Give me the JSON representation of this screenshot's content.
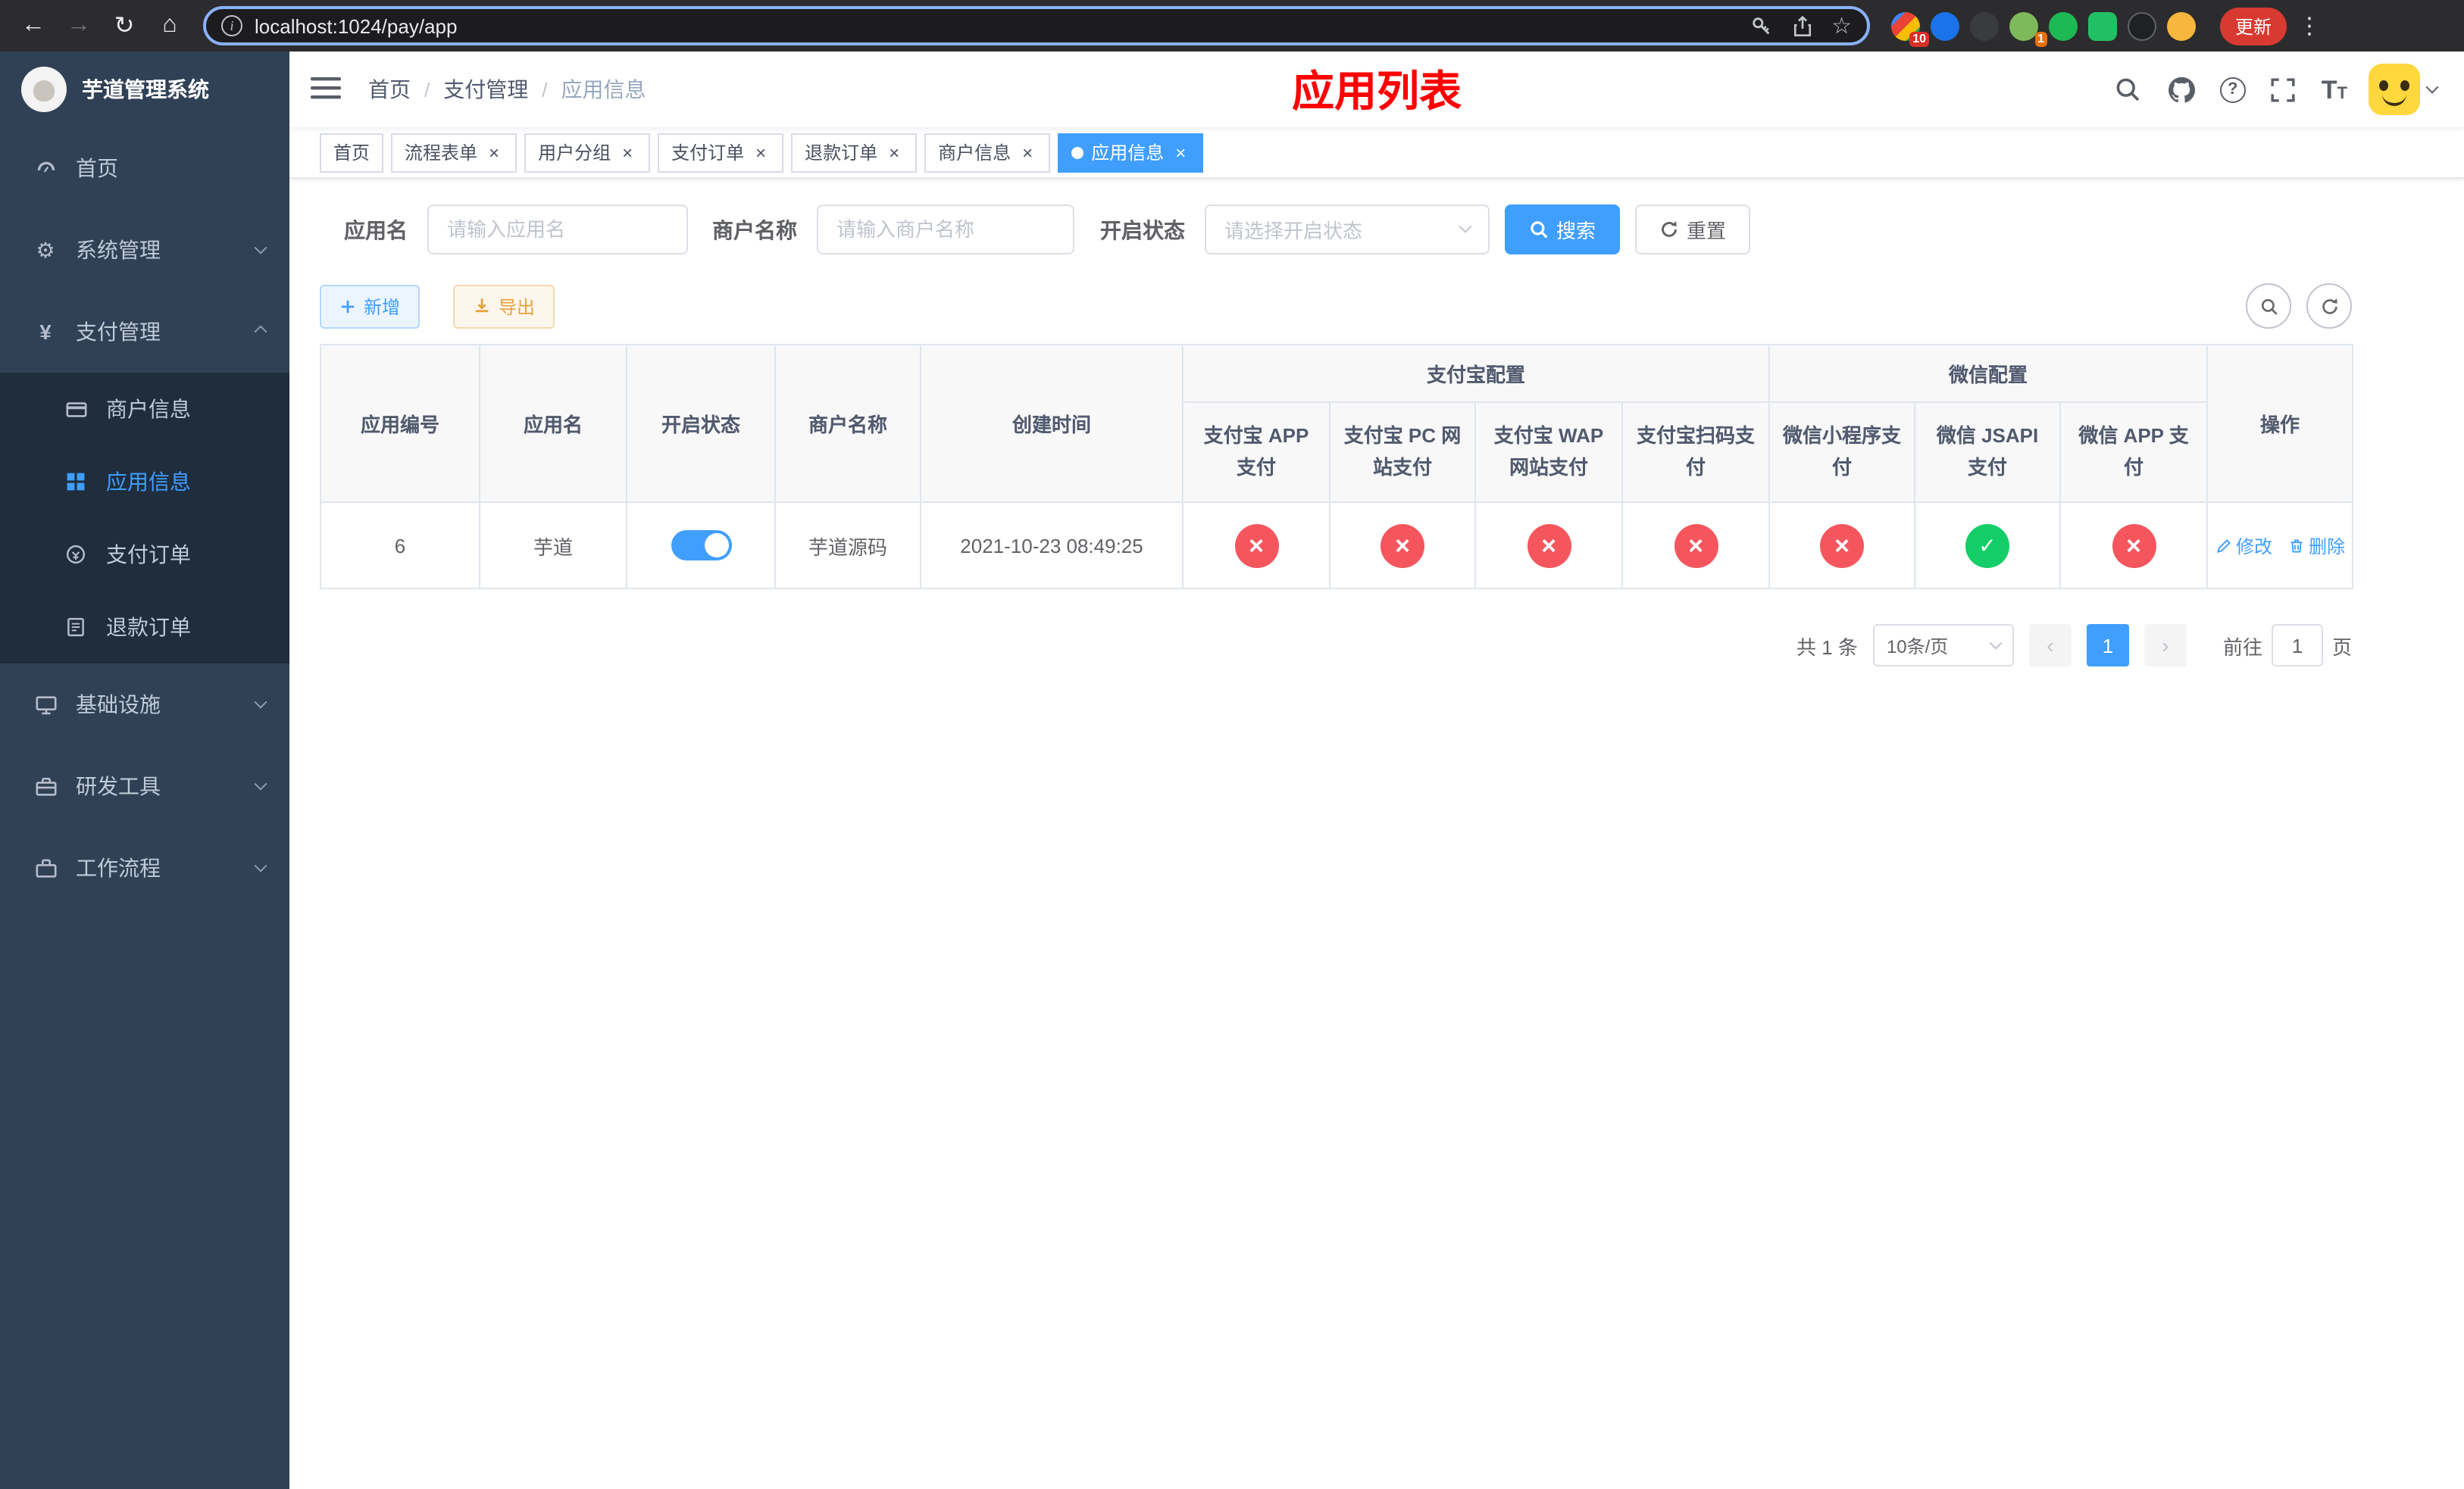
{
  "browser": {
    "url": "localhost:1024/pay/app",
    "update_button": "更新",
    "extension_badges": {
      "apps": "10",
      "avatar": "1"
    }
  },
  "sidebar": {
    "app_title": "芋道管理系统",
    "menu": [
      {
        "label": "首页"
      },
      {
        "label": "系统管理"
      },
      {
        "label": "支付管理"
      },
      {
        "label": "基础设施"
      },
      {
        "label": "研发工具"
      },
      {
        "label": "工作流程"
      }
    ],
    "submenu_pay": [
      {
        "label": "商户信息"
      },
      {
        "label": "应用信息"
      },
      {
        "label": "支付订单"
      },
      {
        "label": "退款订单"
      }
    ]
  },
  "header": {
    "breadcrumb": [
      "首页",
      "支付管理",
      "应用信息"
    ],
    "page_title": "应用列表"
  },
  "tabs": [
    {
      "label": "首页"
    },
    {
      "label": "流程表单"
    },
    {
      "label": "用户分组"
    },
    {
      "label": "支付订单"
    },
    {
      "label": "退款订单"
    },
    {
      "label": "商户信息"
    },
    {
      "label": "应用信息"
    }
  ],
  "filters": {
    "app_name_label": "应用名",
    "app_name_placeholder": "请输入应用名",
    "merchant_label": "商户名称",
    "merchant_placeholder": "请输入商户名称",
    "status_label": "开启状态",
    "status_placeholder": "请选择开启状态",
    "search_button": "搜索",
    "reset_button": "重置"
  },
  "toolbar": {
    "add_button": "新增",
    "export_button": "导出"
  },
  "table": {
    "headers": {
      "app_id": "应用编号",
      "app_name": "应用名",
      "status": "开启状态",
      "merchant": "商户名称",
      "create_time": "创建时间",
      "alipay_group": "支付宝配置",
      "wechat_group": "微信配置",
      "alipay_app": "支付宝 APP 支付",
      "alipay_pc": "支付宝 PC 网站支付",
      "alipay_wap": "支付宝 WAP 网站支付",
      "alipay_qr": "支付宝扫码支付",
      "wechat_lite": "微信小程序支付",
      "wechat_jsapi": "微信 JSAPI 支付",
      "wechat_app": "微信 APP 支付",
      "actions": "操作"
    },
    "rows": [
      {
        "app_id": "6",
        "app_name": "芋道",
        "status_on": true,
        "merchant": "芋道源码",
        "create_time": "2021-10-23 08:49:25",
        "configs": {
          "alipay_app": false,
          "alipay_pc": false,
          "alipay_wap": false,
          "alipay_qr": false,
          "wechat_lite": false,
          "wechat_jsapi": true,
          "wechat_app": false
        },
        "edit_label": "修改",
        "delete_label": "删除"
      }
    ]
  },
  "pagination": {
    "total_text": "共 1 条",
    "page_size": "10条/页",
    "current_page": "1",
    "goto_label": "前往",
    "goto_value": "1",
    "page_unit": "页"
  },
  "colors": {
    "accent": "#409eff",
    "danger": "#f5565e",
    "success": "#13ce66",
    "warning": "#e6a23c",
    "title_red": "#ff0000",
    "sidebar_bg": "#304156",
    "submenu_bg": "#1f2d3d"
  }
}
